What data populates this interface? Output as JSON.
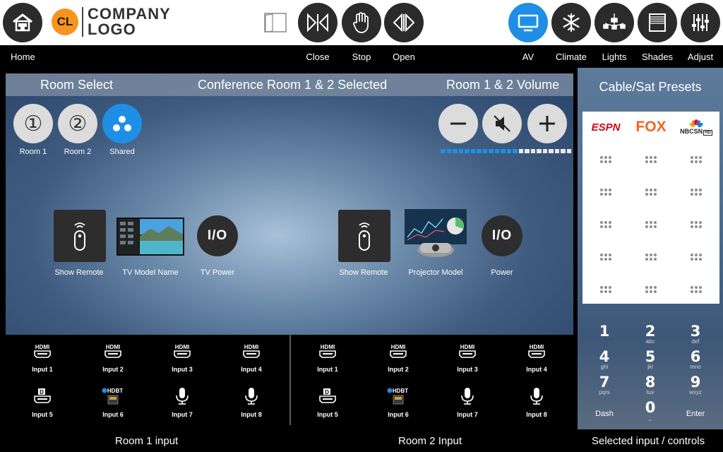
{
  "logo": {
    "initials": "CL",
    "line1": "COMPANY",
    "line2": "LOGO"
  },
  "labels": {
    "home": "Home",
    "close": "Close",
    "stop": "Stop",
    "open": "Open",
    "av": "AV",
    "climate": "Climate",
    "lights": "Lights",
    "shades": "Shades",
    "adjust": "Adjust"
  },
  "header": {
    "room_select": "Room Select",
    "selected": "Conference Room 1 & 2 Selected",
    "volume": "Room 1 & 2 Volume"
  },
  "rooms": [
    {
      "label": "Room 1",
      "glyph": "①"
    },
    {
      "label": "Room 2",
      "glyph": "②"
    },
    {
      "label": "Shared"
    }
  ],
  "volume": {
    "level_fraction": 0.59,
    "segments": 22
  },
  "room1_devices": {
    "remote": "Show Remote",
    "model": "TV Model Name",
    "power": "TV Power",
    "power_glyph": "I/O"
  },
  "room2_devices": {
    "remote": "Show Remote",
    "model": "Projector Model",
    "power": "Power",
    "power_glyph": "I/O"
  },
  "inputs": {
    "room1": [
      "Input 1",
      "Input 2",
      "Input 3",
      "Input 4",
      "Input 5",
      "Input 6",
      "Input 7",
      "Input 8"
    ],
    "room2": [
      "Input 1",
      "Input 2",
      "Input 3",
      "Input 4",
      "Input 5",
      "Input 6",
      "Input 7",
      "Input 8"
    ],
    "hdmi_text": "HDMI",
    "hdbt_text": "HDBT",
    "dp_text": "D"
  },
  "bottom": {
    "room1": "Room 1 input",
    "room2": "Room 2 Input",
    "selected": "Selected input / controls"
  },
  "presets": {
    "title": "Cable/Sat Presets",
    "channels": [
      "ESPN",
      "FOX",
      "NBCSN"
    ],
    "channel_hd": "HD"
  },
  "keypad": {
    "keys": [
      {
        "digit": "1",
        "letters": ""
      },
      {
        "digit": "2",
        "letters": "abc"
      },
      {
        "digit": "3",
        "letters": "def"
      },
      {
        "digit": "4",
        "letters": "ghi"
      },
      {
        "digit": "5",
        "letters": "jkl"
      },
      {
        "digit": "6",
        "letters": "mno"
      },
      {
        "digit": "7",
        "letters": "pqrs"
      },
      {
        "digit": "8",
        "letters": "tuv"
      },
      {
        "digit": "9",
        "letters": "wxyz"
      }
    ],
    "dash": "Dash",
    "zero": "0",
    "zero_sub": "⎵",
    "enter": "Enter"
  },
  "colors": {
    "accent": "#1f8fe6",
    "logo_orange": "#f7941d",
    "espn": "#d0021b",
    "fox": "#f26522"
  }
}
